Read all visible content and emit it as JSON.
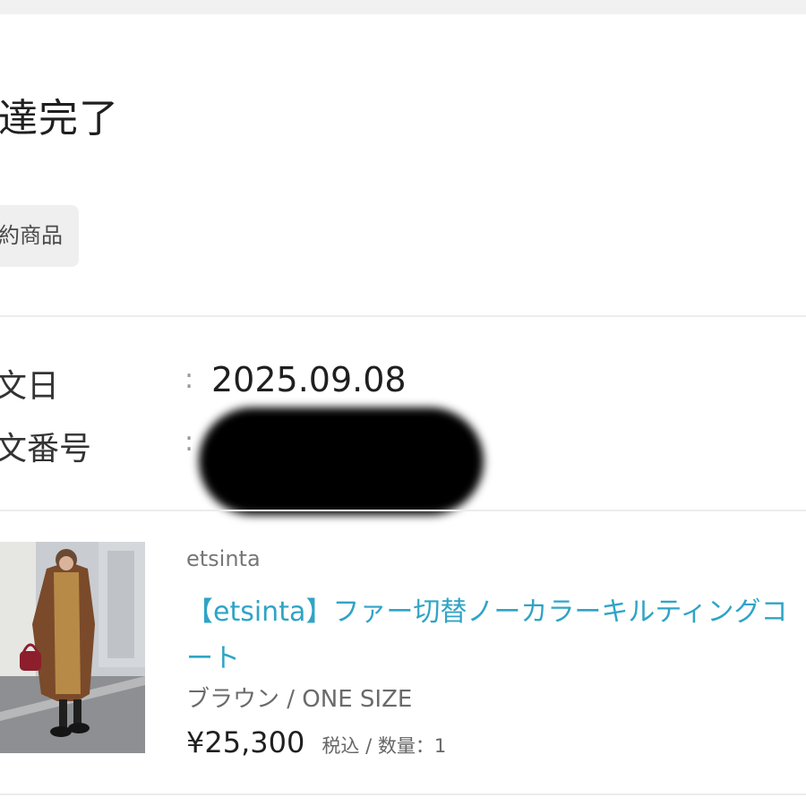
{
  "order": {
    "status_title": "達完了",
    "tag_label": "約商品",
    "info_rows": [
      {
        "label": "文日",
        "separator": ":",
        "value": "2025.09.08"
      },
      {
        "label": "文番号",
        "separator": ":",
        "value": ""
      }
    ]
  },
  "product": {
    "brand": "etsinta",
    "name": "【etsinta】ファー切替ノーカラーキルティングコート",
    "variant": "ブラウン / ONE SIZE",
    "price": "¥25,300",
    "price_meta": "税込 / 数量：1",
    "thumbnail_icon": "product-photo"
  },
  "colors": {
    "link": "#2fa4c6",
    "tag_bg": "#efefef",
    "divider": "#ececec"
  }
}
